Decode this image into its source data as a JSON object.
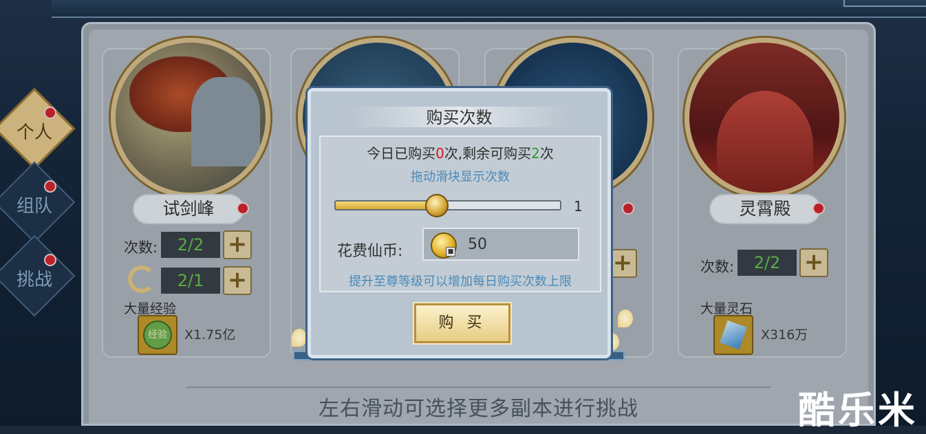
{
  "side_tabs": [
    {
      "label": "个人",
      "active": true
    },
    {
      "label": "组队",
      "active": false
    },
    {
      "label": "挑战",
      "active": false
    }
  ],
  "cards": [
    {
      "name": "试剑峰",
      "count_label": "次数:",
      "count": "2/2",
      "extra_count": "2/1",
      "reward_title": "大量经验",
      "reward_icon_text": "经验",
      "reward_amount": "X1.75亿"
    },
    {
      "name": "灵霄殿",
      "count_label": "次数:",
      "count": "2/2",
      "reward_title": "大量灵石",
      "reward_amount": "X316万"
    }
  ],
  "dialog": {
    "title": "购买次数",
    "purchased_prefix": "今日已购买",
    "purchased_count": "0",
    "purchased_mid": "次,剩余可购买",
    "remaining_count": "2",
    "purchased_suffix": "次",
    "drag_hint": "拖动滑块显示次数",
    "slider_value": "1",
    "slider_fraction": 0.45,
    "cost_label": "花费仙币:",
    "cost_value": "50",
    "upgrade_hint": "提升至尊等级可以增加每日购买次数上限",
    "buy_label": "购 买"
  },
  "bottom_hint": "左右滑动可选择更多副本进行挑战",
  "watermark": "酷乐米",
  "colors": {
    "accent_gold": "#e7cc84",
    "count_green": "#63c24a",
    "hint_blue": "#4a8ab9",
    "red_number": "#d01c1c"
  }
}
